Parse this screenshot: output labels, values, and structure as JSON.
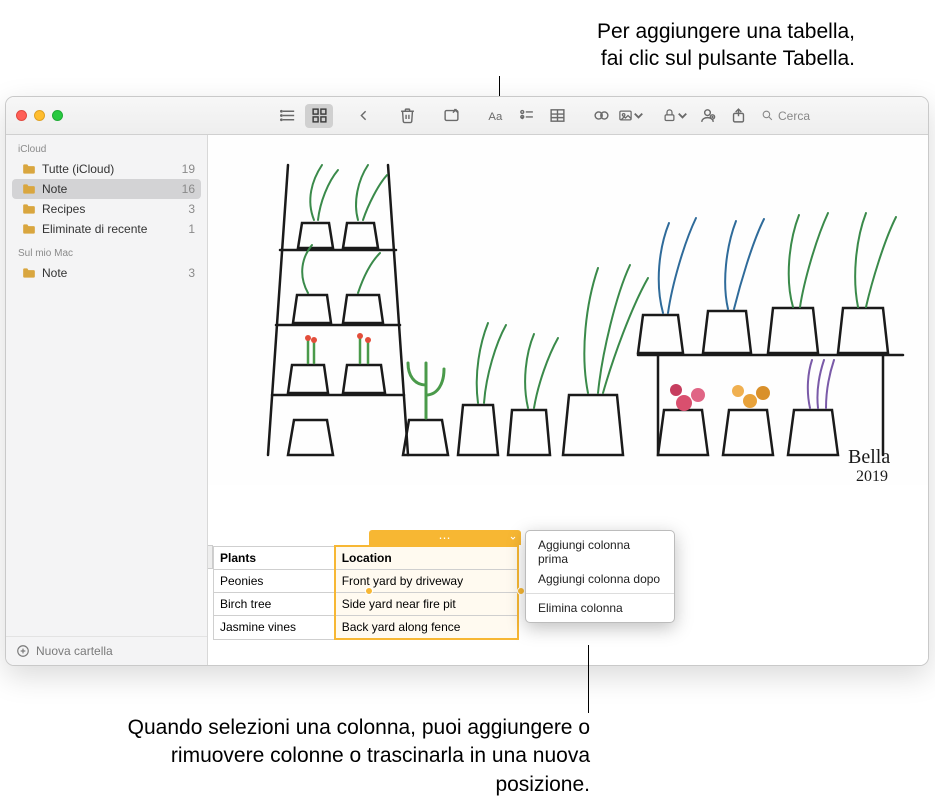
{
  "callouts": {
    "top": "Per aggiungere una tabella,\nfai clic sul pulsante Tabella.",
    "bottom": "Quando selezioni una colonna, puoi aggiungere o rimuovere colonne o trascinarla in una nuova posizione."
  },
  "search": {
    "placeholder": "Cerca"
  },
  "sidebar": {
    "sections": [
      {
        "title": "iCloud",
        "items": [
          {
            "label": "Tutte (iCloud)",
            "count": "19",
            "selected": false
          },
          {
            "label": "Note",
            "count": "16",
            "selected": true
          },
          {
            "label": "Recipes",
            "count": "3",
            "selected": false
          },
          {
            "label": "Eliminate di recente",
            "count": "1",
            "selected": false
          }
        ]
      },
      {
        "title": "Sul mio Mac",
        "items": [
          {
            "label": "Note",
            "count": "3",
            "selected": false
          }
        ]
      }
    ],
    "footer": "Nuova cartella"
  },
  "signature": {
    "name": "Bella",
    "year": "2019"
  },
  "table": {
    "headers": [
      "Plants",
      "Location"
    ],
    "rows": [
      [
        "Peonies",
        "Front yard by driveway"
      ],
      [
        "Birch tree",
        "Side yard near fire pit"
      ],
      [
        "Jasmine vines",
        "Back yard along fence"
      ]
    ]
  },
  "context_menu": {
    "items": [
      "Aggiungi colonna prima",
      "Aggiungi colonna dopo"
    ],
    "items2": [
      "Elimina colonna"
    ]
  }
}
